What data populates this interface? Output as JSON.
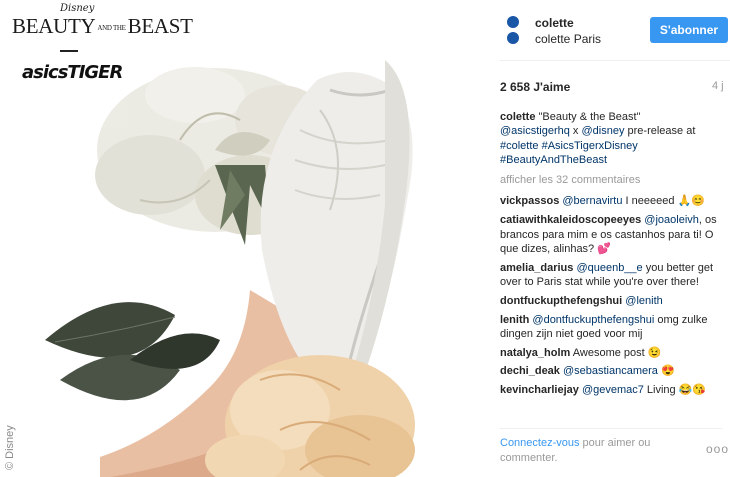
{
  "photo": {
    "brand_disney": "Disney",
    "brand_title_left": "BEAUTY",
    "brand_title_small": "AND THE",
    "brand_title_right": "BEAST",
    "brand_asics": "asicsTIGER",
    "copyright": "© Disney"
  },
  "header": {
    "username": "colette",
    "location": "colette Paris",
    "follow_label": "S'abonner",
    "avatar_color": "#1a56a6"
  },
  "post": {
    "likes": "2 658 J'aime",
    "age": "4 j",
    "caption_user": "colette",
    "caption_text": " \"Beauty & the Beast\"",
    "caption_m1": "@asicstigerhq",
    "caption_x": " x ",
    "caption_m2": "@disney",
    "caption_rest": " pre-release at",
    "caption_t1": "#colette",
    "caption_t2": "#AsicsTigerxDisney",
    "caption_t3": "#BeautyAndTheBeast",
    "show_all": "afficher les 32 commentaires"
  },
  "comments": [
    {
      "user": "vickpassos",
      "mention": "@bernavirtu",
      "text": " I neeeeed 🙏😊"
    },
    {
      "user": "catiawithkaleidoscopeeyes",
      "mention": "@joaoleivh",
      "text": ", os brancos para mim e os castanhos para ti! O que dizes, alinhas? 💕"
    },
    {
      "user": "amelia_darius",
      "mention": "@queenb__e",
      "text": " you better get over to Paris stat while you're over there!"
    },
    {
      "user": "dontfuckupthefengshui",
      "mention": "@lenith",
      "text": ""
    },
    {
      "user": "lenith",
      "mention": "@dontfuckupthefengshui",
      "text": " omg zulke dingen zijn niet goed voor mij"
    },
    {
      "user": "natalya_holm",
      "mention": "",
      "text": "Awesome post 😉"
    },
    {
      "user": "dechi_deak",
      "mention": "@sebastiancamera",
      "text": " 😍"
    },
    {
      "user": "kevincharliejay",
      "mention": "@gevemac7",
      "text": " Living 😂😘"
    }
  ],
  "footer": {
    "login_link": "Connectez-vous",
    "login_text": " pour aimer ou commenter.",
    "more": "ooo"
  },
  "colors": {
    "accent": "#3897f0",
    "mention": "#003569",
    "muted": "#999999"
  }
}
